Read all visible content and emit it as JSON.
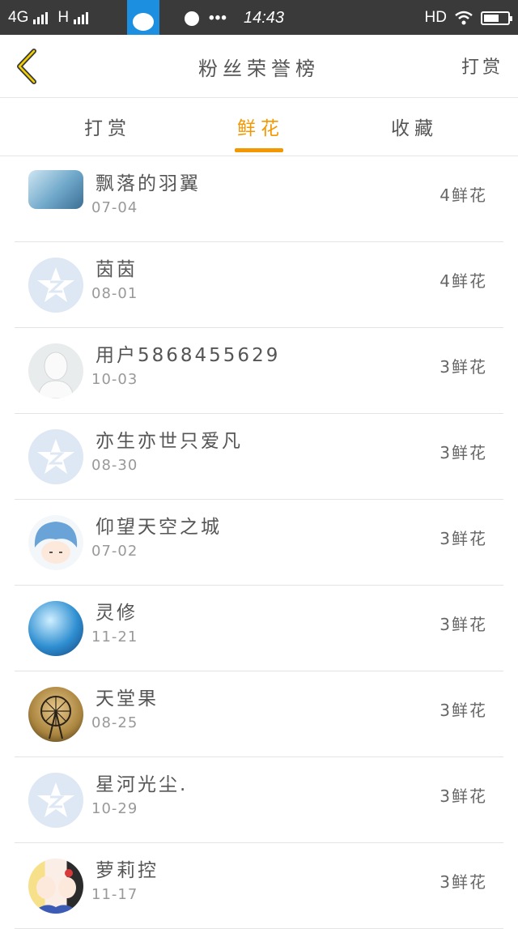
{
  "status_bar": {
    "network": "4G",
    "network2": "H",
    "app_badge": "vivo",
    "time": "14:43",
    "hd": "HD"
  },
  "header": {
    "title": "粉丝荣誉榜",
    "action": "打赏"
  },
  "tabs": [
    {
      "label": "打赏",
      "active": false
    },
    {
      "label": "鲜花",
      "active": true
    },
    {
      "label": "收藏",
      "active": false
    }
  ],
  "accent_color": "#f39800",
  "fans": [
    {
      "name": "飘落的羽翼",
      "date": "07-04",
      "count": "4鲜花",
      "avatar": "photo"
    },
    {
      "name": "茵茵",
      "date": "08-01",
      "count": "4鲜花",
      "avatar": "qq-default"
    },
    {
      "name": "用户5868455629",
      "date": "10-03",
      "count": "3鲜花",
      "avatar": "blank-person"
    },
    {
      "name": "亦生亦世只爱凡",
      "date": "08-30",
      "count": "3鲜花",
      "avatar": "qq-default"
    },
    {
      "name": "仰望天空之城",
      "date": "07-02",
      "count": "3鲜花",
      "avatar": "anime-boy"
    },
    {
      "name": "灵修",
      "date": "11-21",
      "count": "3鲜花",
      "avatar": "blue-art"
    },
    {
      "name": "天堂果",
      "date": "08-25",
      "count": "3鲜花",
      "avatar": "ferris-wheel"
    },
    {
      "name": "星河光尘.",
      "date": "10-29",
      "count": "3鲜花",
      "avatar": "qq-default"
    },
    {
      "name": "萝莉控",
      "date": "11-17",
      "count": "3鲜花",
      "avatar": "anime-girls"
    }
  ]
}
